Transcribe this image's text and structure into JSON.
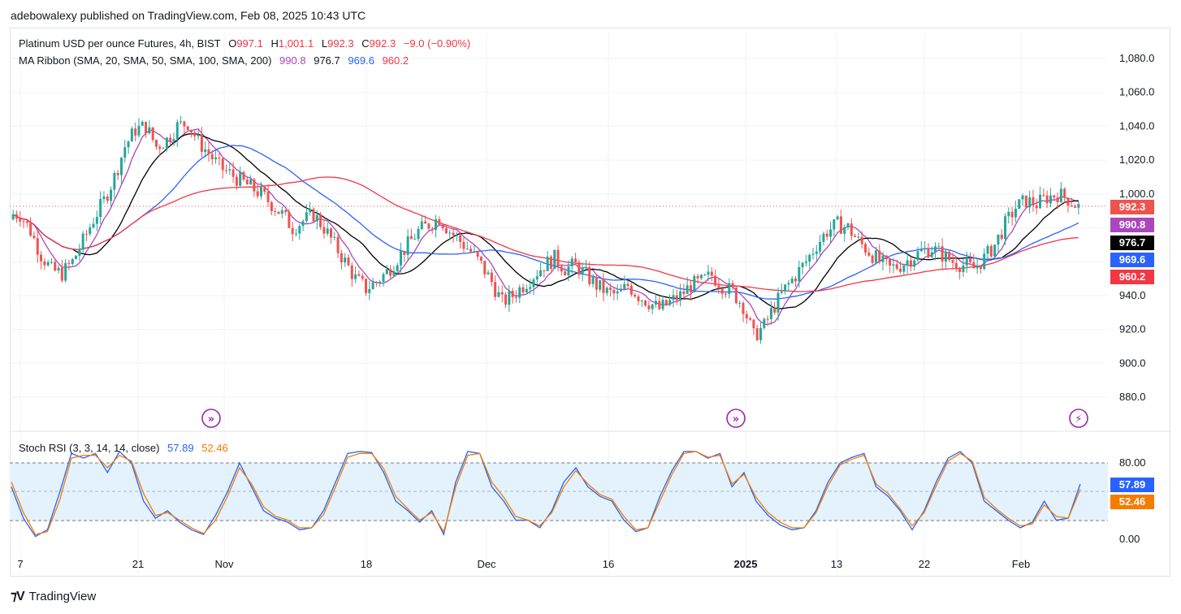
{
  "header": {
    "published_text": "adebowalexy published on TradingView.com, Feb 08, 2025 10:43 UTC"
  },
  "footer": {
    "brand": "TradingView"
  },
  "legend": {
    "symbol": "Platinum USD per ounce Futures, 4h, BIST",
    "open_label": "O",
    "open": "997.1",
    "high_label": "H",
    "high": "1,001.1",
    "low_label": "L",
    "low": "992.3",
    "close_label": "C",
    "close": "992.3",
    "change": "−9.0 (−0.90%)",
    "ma_title": "MA Ribbon (SMA, 20, SMA, 50, SMA, 100, SMA, 200)",
    "ma20": "990.8",
    "ma50": "976.7",
    "ma100": "969.6",
    "ma200": "960.2",
    "rsi_title": "Stoch RSI (3, 3, 14, 14, close)",
    "rsi_k": "57.89",
    "rsi_d": "52.46"
  },
  "price_badges": {
    "last": "992.3",
    "ma20": "990.8",
    "ma50": "976.7",
    "ma100": "969.6",
    "ma200": "960.2",
    "rsi_k": "57.89",
    "rsi_d": "52.46"
  },
  "colors": {
    "up": "#26a69a",
    "down": "#ef5350",
    "ma20": "#ab47bc",
    "ma50": "#000000",
    "ma100": "#2962ff",
    "ma200": "#f23645",
    "rsi_k": "#2962ff",
    "rsi_d": "#f57c00",
    "rsi_band": "#e3f2fd",
    "event_icon": "#9c27b0"
  },
  "event_icons": [
    "arrows-right-icon",
    "arrows-right-icon",
    "lightning-icon"
  ],
  "chart_data": [
    {
      "type": "candlestick",
      "title": "Platinum USD per ounce Futures, 4h, BIST",
      "y_ticks": [
        "1,080.0",
        "1,060.0",
        "1,040.0",
        "1,020.0",
        "1,000.0",
        "980.0",
        "960.0",
        "940.0",
        "920.0",
        "900.0",
        "880.0"
      ],
      "ylim": [
        871,
        1088
      ],
      "x_ticks": [
        "7",
        "21",
        "Nov",
        "18",
        "Dec",
        "16",
        "2025",
        "13",
        "22",
        "Feb"
      ],
      "grid": true,
      "last_price": 992.3,
      "ma_values": {
        "sma20": 990.8,
        "sma50": 976.7,
        "sma100": 969.6,
        "sma200": 960.2
      },
      "close_series": [
        988,
        978,
        964,
        955,
        953,
        960,
        972,
        985,
        996,
        1010,
        1028,
        1038,
        1040,
        1028,
        1032,
        1040,
        1042,
        1031,
        1024,
        1016,
        1012,
        1008,
        1004,
        1000,
        994,
        988,
        980,
        984,
        988,
        980,
        970,
        960,
        950,
        944,
        948,
        954,
        962,
        970,
        978,
        982,
        986,
        978,
        972,
        966,
        958,
        948,
        936,
        940,
        946,
        952,
        958,
        962,
        956,
        958,
        952,
        946,
        942,
        940,
        946,
        940,
        936,
        932,
        936,
        940,
        946,
        948,
        952,
        946,
        942,
        934,
        916,
        922,
        934,
        944,
        952,
        960,
        970,
        978,
        982,
        980,
        972,
        966,
        960,
        956,
        958,
        962,
        966,
        968,
        964,
        960,
        958,
        956,
        962,
        970,
        982,
        992,
        996,
        994,
        998,
        1000,
        997.1,
        992.3
      ],
      "ohlc_summary": {
        "open": 997.1,
        "high": 1001.1,
        "low": 992.3,
        "close": 992.3,
        "change": -9.0,
        "change_pct": -0.9
      }
    },
    {
      "type": "line",
      "title": "Stoch RSI (3, 3, 14, 14, close)",
      "y_ticks": [
        "80.00",
        "0.00"
      ],
      "ylim": [
        -10,
        100
      ],
      "band": [
        20,
        80
      ],
      "series": [
        {
          "name": "K",
          "values": [
            55,
            22,
            3,
            10,
            48,
            90,
            85,
            90,
            70,
            92,
            80,
            40,
            22,
            30,
            18,
            10,
            5,
            25,
            50,
            80,
            55,
            30,
            22,
            18,
            10,
            12,
            30,
            60,
            90,
            92,
            91,
            70,
            40,
            30,
            18,
            30,
            5,
            60,
            92,
            90,
            55,
            40,
            20,
            20,
            12,
            30,
            60,
            75,
            55,
            45,
            40,
            20,
            8,
            12,
            45,
            72,
            92,
            92,
            85,
            90,
            55,
            70,
            40,
            25,
            15,
            10,
            12,
            30,
            60,
            80,
            86,
            90,
            55,
            45,
            30,
            10,
            30,
            60,
            85,
            92,
            80,
            40,
            30,
            20,
            12,
            18,
            40,
            20,
            22,
            57.89
          ]
        },
        {
          "name": "D",
          "values": [
            60,
            28,
            5,
            8,
            40,
            85,
            88,
            88,
            75,
            88,
            82,
            48,
            25,
            28,
            20,
            12,
            6,
            20,
            45,
            75,
            58,
            34,
            24,
            20,
            12,
            12,
            26,
            55,
            86,
            90,
            90,
            74,
            45,
            32,
            20,
            28,
            8,
            55,
            88,
            90,
            60,
            44,
            24,
            20,
            14,
            28,
            55,
            72,
            58,
            47,
            42,
            24,
            10,
            12,
            40,
            68,
            90,
            92,
            86,
            88,
            58,
            68,
            44,
            28,
            18,
            12,
            12,
            28,
            56,
            78,
            84,
            88,
            58,
            48,
            32,
            14,
            28,
            56,
            82,
            90,
            82,
            44,
            32,
            22,
            14,
            16,
            36,
            24,
            22,
            52.46
          ]
        }
      ]
    }
  ]
}
